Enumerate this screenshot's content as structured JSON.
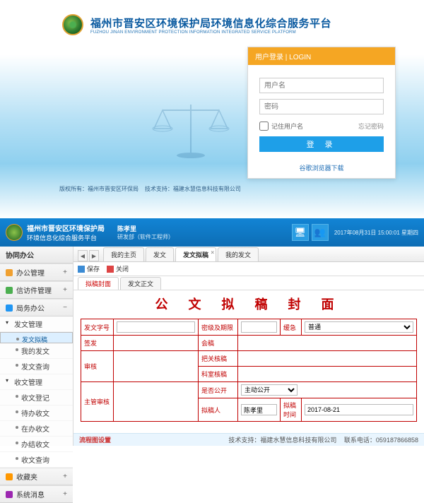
{
  "login": {
    "title_cn": "福州市晋安区环境保护局环境信息化综合服务平台",
    "title_en": "FUZHOU JINAN ENVIRONMENT PROTECTION INFORMATION INTEGRATED SERVICE PLATFORM",
    "head": "用户登录 | LOGIN",
    "user_ph": "用户名",
    "pass_ph": "密码",
    "remember": "记住用户名",
    "forgot": "忘记密码",
    "submit": "登  录",
    "download": "谷歌浏览器下载",
    "copyright_owner": "版权所有：福州市晋安区环保局",
    "tech_support": "技术支持：福建水慧信息科技有限公司"
  },
  "app": {
    "title1": "福州市晋安区环境保护局",
    "title2": "环境信息化综合服务平台",
    "user": "陈孝里",
    "role": "研发部（软件工程师）",
    "clock": "2017年08月31日 15:00:01 星期四",
    "sidebar": {
      "head": "协同办公",
      "groups": [
        {
          "label": "办公管理",
          "open": false
        },
        {
          "label": "信访件管理",
          "open": false
        },
        {
          "label": "局务办公",
          "open": true,
          "children": [
            {
              "label": "发文管理",
              "arrow": true,
              "children": [
                {
                  "label": "发文拟稿",
                  "sel": true
                },
                {
                  "label": "我的发文"
                },
                {
                  "label": "发文查询"
                }
              ]
            },
            {
              "label": "收文管理",
              "arrow": true,
              "children": [
                {
                  "label": "收文登记"
                },
                {
                  "label": "待办收文"
                },
                {
                  "label": "在办收文"
                },
                {
                  "label": "办结收文"
                },
                {
                  "label": "收文查询"
                }
              ]
            }
          ]
        },
        {
          "label": "收藏夹",
          "open": false
        },
        {
          "label": "系统消息",
          "open": false
        }
      ]
    },
    "tabs": {
      "home": "我的主页",
      "send": "发文",
      "draft": "发文拟稿",
      "mysend": "我的发文"
    },
    "toolbar": {
      "save": "保存",
      "close": "关闭"
    },
    "subtabs": {
      "cover": "拟稿封面",
      "body": "发文正文"
    },
    "form": {
      "title": "公 文 拟 稿 封 面",
      "doc_no": "发文字号",
      "secrecy": "密级及期限",
      "urgency": "缓急",
      "urgency_val": "普通",
      "signoff": "签发",
      "countersign": "会稿",
      "office_review": "把关核稿",
      "review": "审核",
      "section_review": "科室核稿",
      "is_public": "是否公开",
      "is_public_val": "主动公开",
      "supervisor": "主管审核",
      "drafter": "拟稿人",
      "drafter_val": "陈孝里",
      "draft_time": "拟稿时间",
      "draft_time_val": "2017-08-21"
    },
    "status": {
      "link": "流程图设置",
      "tech": "技术支持：福建水慧信息科技有限公司",
      "phone": "联系电话：059187866858"
    }
  }
}
